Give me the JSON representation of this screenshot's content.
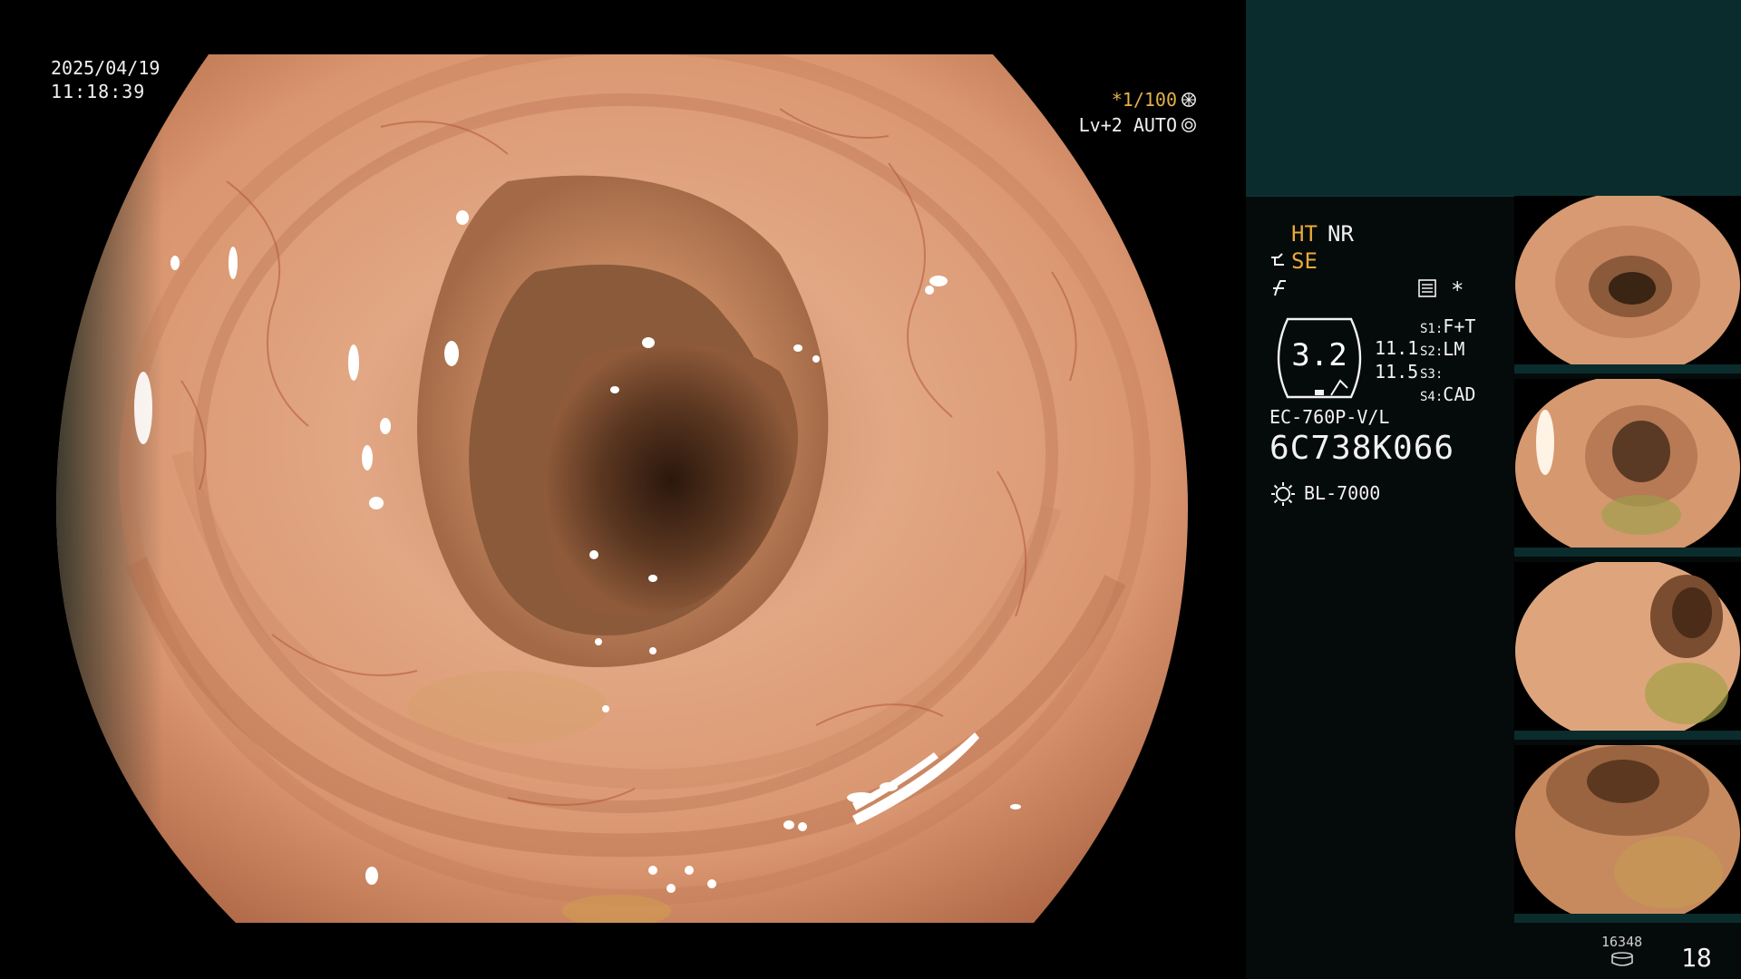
{
  "datetime": {
    "date": "2025/04/19",
    "time": "11:18:39"
  },
  "overlay": {
    "shutter": "*1/100",
    "iris": "Lv+2 AUTO",
    "shutter_icon": "aperture-icon",
    "iris_icon": "auto-iris-icon"
  },
  "panel": {
    "ht": "HT",
    "nr": "NR",
    "se": "SE",
    "star": "*",
    "zoom": "3.2",
    "values": [
      "11.1",
      "11.5"
    ],
    "switches": [
      {
        "key": "S1:",
        "value": "F+T"
      },
      {
        "key": "S2:",
        "value": "LM"
      },
      {
        "key": "S3:",
        "value": ""
      },
      {
        "key": "S4:",
        "value": "CAD"
      }
    ],
    "scope_model": "EC-760P-V/L",
    "scope_serial": "6C738K066",
    "light_source": "BL-7000",
    "count_small": "16348",
    "count_large": "18",
    "colors": {
      "teal_band": "#0b2c2d",
      "accent_orange": "#e9a93c",
      "text": "#f2f2f2"
    }
  },
  "thumbnails": [
    {
      "label": "thumbnail-1"
    },
    {
      "label": "thumbnail-2"
    },
    {
      "label": "thumbnail-3"
    },
    {
      "label": "thumbnail-4"
    }
  ]
}
